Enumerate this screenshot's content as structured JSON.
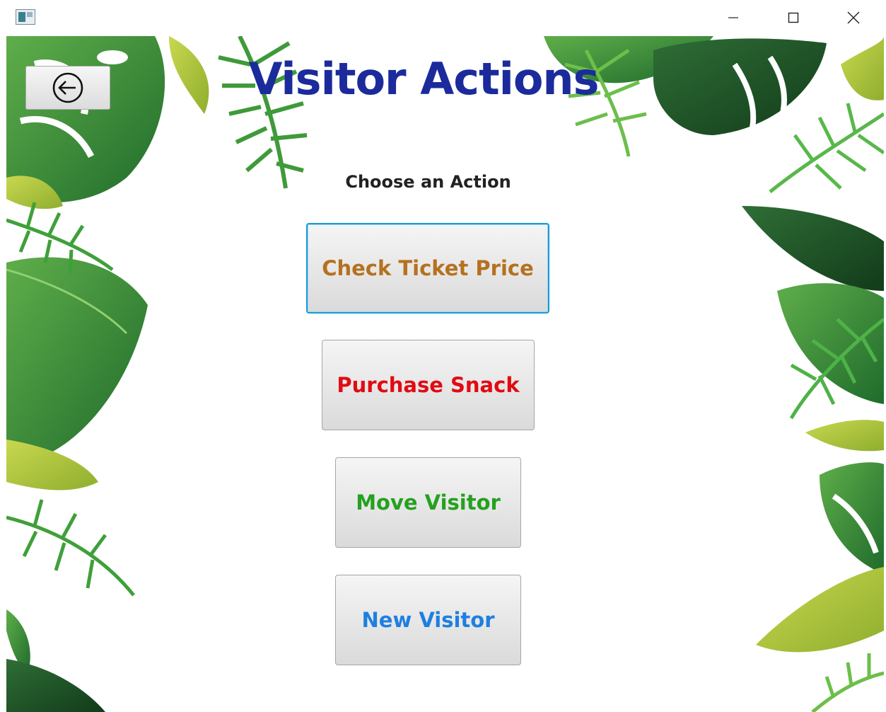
{
  "window": {
    "icons": {
      "app": "app-icon",
      "minimize": "minimize-icon",
      "maximize": "maximize-icon",
      "close": "close-icon"
    }
  },
  "header": {
    "title": "Visitor Actions",
    "title_color": "#1b2b9c",
    "back_icon": "back-arrow-icon"
  },
  "main": {
    "subtitle": "Choose an Action",
    "actions": [
      {
        "label": "Check Ticket Price",
        "color": "#b5711f"
      },
      {
        "label": "Purchase Snack",
        "color": "#e10b12"
      },
      {
        "label": "Move Visitor",
        "color": "#25a11f"
      },
      {
        "label": "New Visitor",
        "color": "#1f7fe0"
      }
    ]
  },
  "background": {
    "theme": "tropical-leaves"
  }
}
